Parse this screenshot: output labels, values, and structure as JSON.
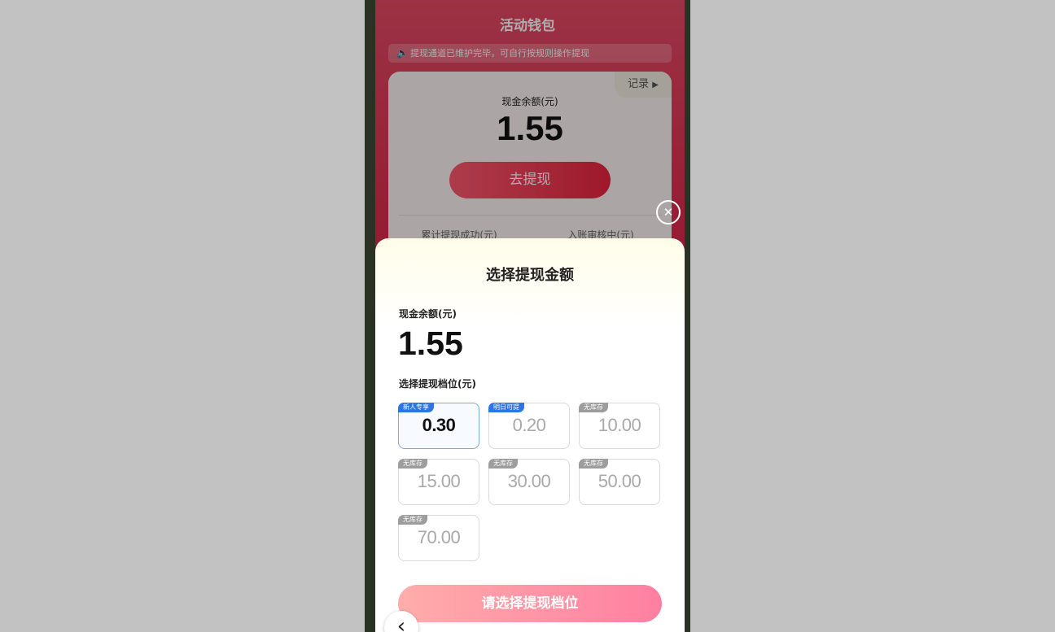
{
  "background_page": {
    "title": "活动钱包",
    "notice": "提现通道已维护完毕，可自行按规则操作提现",
    "notice_icon": "speaker-icon",
    "record_label": "记录",
    "balance_label": "现金余额(元)",
    "balance_value": "1.55",
    "withdraw_button": "去提现",
    "stats": [
      {
        "label": "累计提现成功(元)"
      },
      {
        "label": "入账审核中(元)"
      }
    ]
  },
  "sheet": {
    "title": "选择提现金额",
    "balance_label": "现金余额(元)",
    "balance_value": "1.55",
    "tier_label": "选择提现档位(元)",
    "options": [
      {
        "badge": "新人专享",
        "value": "0.30",
        "selected": true
      },
      {
        "badge": "明日可提",
        "value": "0.20",
        "selected": false
      },
      {
        "badge": "无库存",
        "value": "10.00",
        "selected": false
      },
      {
        "badge": "无库存",
        "value": "15.00",
        "selected": false
      },
      {
        "badge": "无库存",
        "value": "30.00",
        "selected": false
      },
      {
        "badge": "无库存",
        "value": "50.00",
        "selected": false
      },
      {
        "badge": "无库存",
        "value": "70.00",
        "selected": false
      }
    ],
    "submit_button": "请选择提现档位"
  },
  "icons": {
    "close": "close-icon",
    "back": "back-chevron-icon",
    "record_arrow": "triangle-right-icon"
  },
  "colors": {
    "accent_red": "#e8243f",
    "selected_border": "#7ea7e4",
    "badge_blue": "#2d74e6",
    "badge_gray": "#9d9d9d"
  }
}
